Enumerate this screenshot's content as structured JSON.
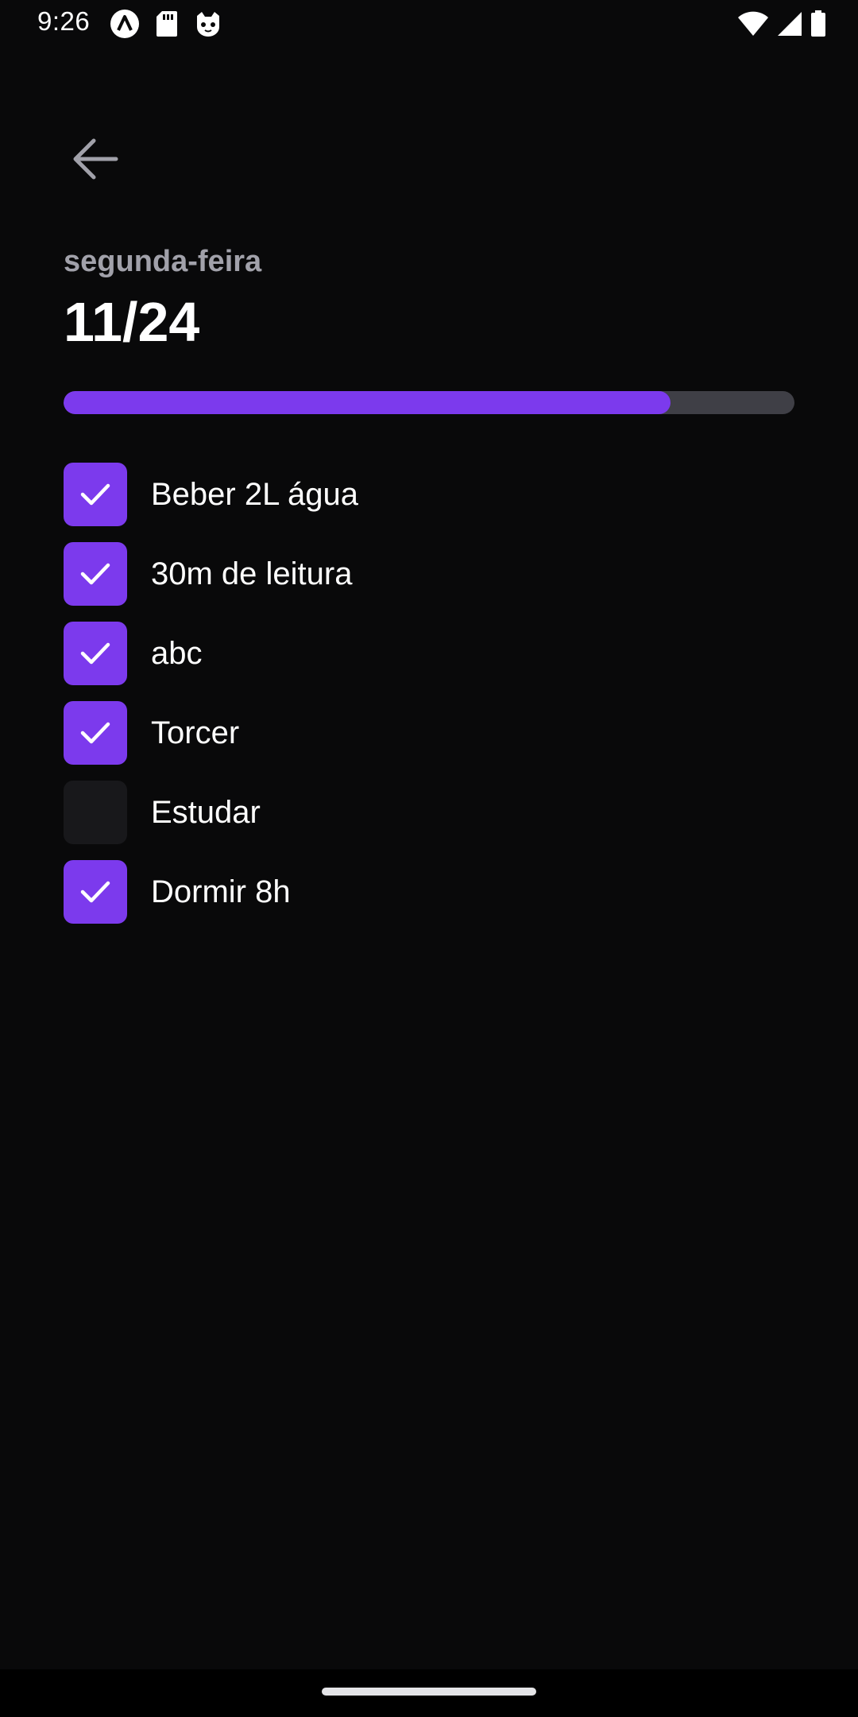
{
  "status_bar": {
    "time": "9:26",
    "left_icons": [
      "app-logo-icon",
      "sd-card-icon",
      "cat-face-icon"
    ],
    "right_icons": [
      "wifi-icon",
      "cellular-signal-icon",
      "battery-icon"
    ]
  },
  "header": {
    "back_icon": "arrow-left-icon",
    "weekday": "segunda-feira",
    "date": "11/24"
  },
  "progress": {
    "fraction": 0.83,
    "color": "#7c3aed",
    "track_color": "#3f3f46"
  },
  "habits": [
    {
      "label": "Beber 2L água",
      "checked": true
    },
    {
      "label": "30m de leitura",
      "checked": true
    },
    {
      "label": "abc",
      "checked": true
    },
    {
      "label": "Torcer",
      "checked": true
    },
    {
      "label": "Estudar",
      "checked": false
    },
    {
      "label": "Dormir 8h",
      "checked": true
    }
  ],
  "colors": {
    "background": "#09090a",
    "accent": "#7c3aed",
    "muted_text": "#a1a1aa",
    "unchecked_box": "#18181b"
  }
}
